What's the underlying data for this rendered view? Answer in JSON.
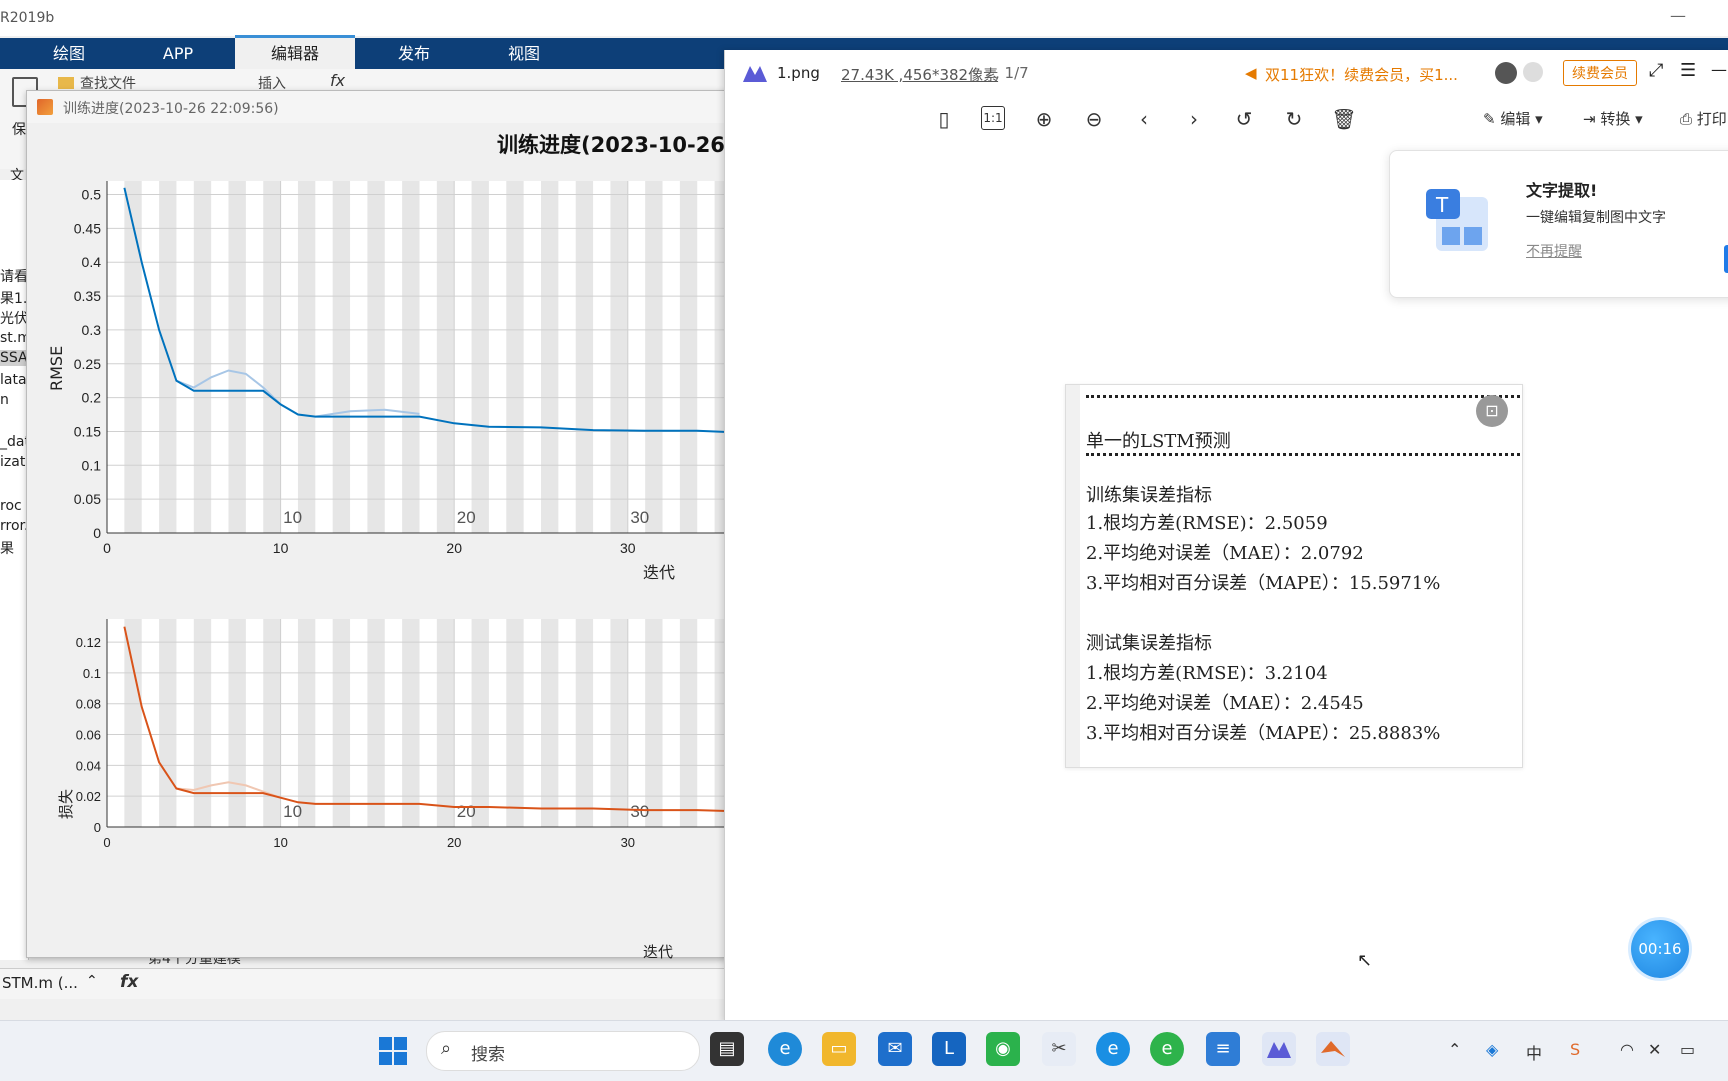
{
  "matlab": {
    "title": "R2019b",
    "minimize": "—",
    "tabs": [
      "绘图",
      "APP",
      "编辑器",
      "发布",
      "视图"
    ],
    "ribbon": {
      "find_files": "查找文件",
      "insert": "插入",
      "save": "保",
      "file_section": "文"
    },
    "file_list": [
      "请看",
      "果1.",
      "光伏",
      "st.m",
      "SSA",
      "lata.",
      "n",
      "_dat",
      "izati",
      "roc",
      "rror.",
      "果"
    ],
    "command_file": "STM.m  (...",
    "fx": "fx",
    "bottom_text": "第4个分量建模"
  },
  "figure": {
    "window_title": "训练进度(2023-10-26 22:09:56)",
    "heading": "训练进度(2023-10-26",
    "top_plot_ylabel": "RMSE",
    "bottom_plot_ylabel": "损失",
    "xlabel": "迭代"
  },
  "chart_data": [
    {
      "type": "line",
      "title": "",
      "ylabel": "RMSE",
      "xlabel": "迭代",
      "ylim": [
        0,
        0.52
      ],
      "xlim": [
        0,
        40
      ],
      "yticks": [
        0,
        0.05,
        0.1,
        0.15,
        0.2,
        0.25,
        0.3,
        0.35,
        0.4,
        0.45,
        0.5
      ],
      "xticks": [
        0,
        10,
        20,
        30
      ],
      "epoch_labels": [
        "10",
        "20",
        "30"
      ],
      "grid": true,
      "series": [
        {
          "color": "#0072bd",
          "x": [
            1,
            2,
            3,
            4,
            5,
            6,
            7,
            8,
            9,
            10,
            11,
            12,
            14,
            16,
            18,
            20,
            22,
            25,
            28,
            31,
            34,
            37,
            40
          ],
          "y": [
            0.51,
            0.4,
            0.3,
            0.225,
            0.21,
            0.21,
            0.21,
            0.21,
            0.21,
            0.19,
            0.175,
            0.172,
            0.172,
            0.172,
            0.172,
            0.162,
            0.157,
            0.156,
            0.152,
            0.151,
            0.151,
            0.148,
            0.145
          ]
        },
        {
          "color": "#a7c6e6",
          "x": [
            4,
            5,
            6,
            7,
            8,
            9,
            10
          ],
          "y": [
            0.225,
            0.215,
            0.23,
            0.24,
            0.235,
            0.215,
            0.19
          ]
        },
        {
          "color": "#a7c6e6",
          "x": [
            12,
            14,
            16,
            18
          ],
          "y": [
            0.172,
            0.18,
            0.182,
            0.176
          ]
        }
      ]
    },
    {
      "type": "line",
      "title": "",
      "ylabel": "损失",
      "xlabel": "迭代",
      "ylim": [
        0,
        0.135
      ],
      "xlim": [
        0,
        40
      ],
      "yticks": [
        0,
        0.02,
        0.04,
        0.06,
        0.08,
        0.1,
        0.12
      ],
      "xticks": [
        0,
        10,
        20,
        30
      ],
      "epoch_labels": [
        "10",
        "20",
        "30"
      ],
      "grid": true,
      "series": [
        {
          "color": "#d95319",
          "x": [
            1,
            2,
            3,
            4,
            5,
            6,
            7,
            8,
            9,
            10,
            11,
            12,
            14,
            16,
            18,
            20,
            22,
            25,
            28,
            31,
            34,
            37,
            40
          ],
          "y": [
            0.13,
            0.078,
            0.042,
            0.025,
            0.022,
            0.022,
            0.022,
            0.022,
            0.022,
            0.019,
            0.016,
            0.015,
            0.015,
            0.015,
            0.015,
            0.013,
            0.013,
            0.012,
            0.012,
            0.011,
            0.011,
            0.01,
            0.01
          ]
        },
        {
          "color": "#f0c7b2",
          "x": [
            4,
            5,
            6,
            7,
            8,
            9,
            10
          ],
          "y": [
            0.025,
            0.024,
            0.027,
            0.029,
            0.027,
            0.023,
            0.019
          ]
        }
      ]
    }
  ],
  "viewer": {
    "file_name": "1.png",
    "file_info": "27.43K ,456*382像素",
    "page": ", 1/7",
    "promo": "双11狂欢！续费会员，买1...",
    "vip_button": "续费会员",
    "edit": "编辑",
    "convert": "转换",
    "print": "打印",
    "ocr_card": {
      "title": "文字提取!",
      "desc": "一键编辑复制图中文字",
      "dismiss": "不再提醒"
    },
    "timer": "00:16",
    "document": {
      "heading": "单一的LSTM预测",
      "train_title": "训练集误差指标",
      "train_1": "1.根均方差(RMSE)：2.5059",
      "train_2": "2.平均绝对误差（MAE）：2.0792",
      "train_3": "3.平均相对百分误差（MAPE）：15.5971%",
      "test_title": "测试集误差指标",
      "test_1": "1.根均方差(RMSE)：3.2104",
      "test_2": "2.平均绝对误差（MAE）：2.4545",
      "test_3": "3.平均相对百分误差（MAPE）：25.8883%"
    }
  },
  "taskbar": {
    "search_placeholder": "搜索",
    "ime": "中"
  }
}
